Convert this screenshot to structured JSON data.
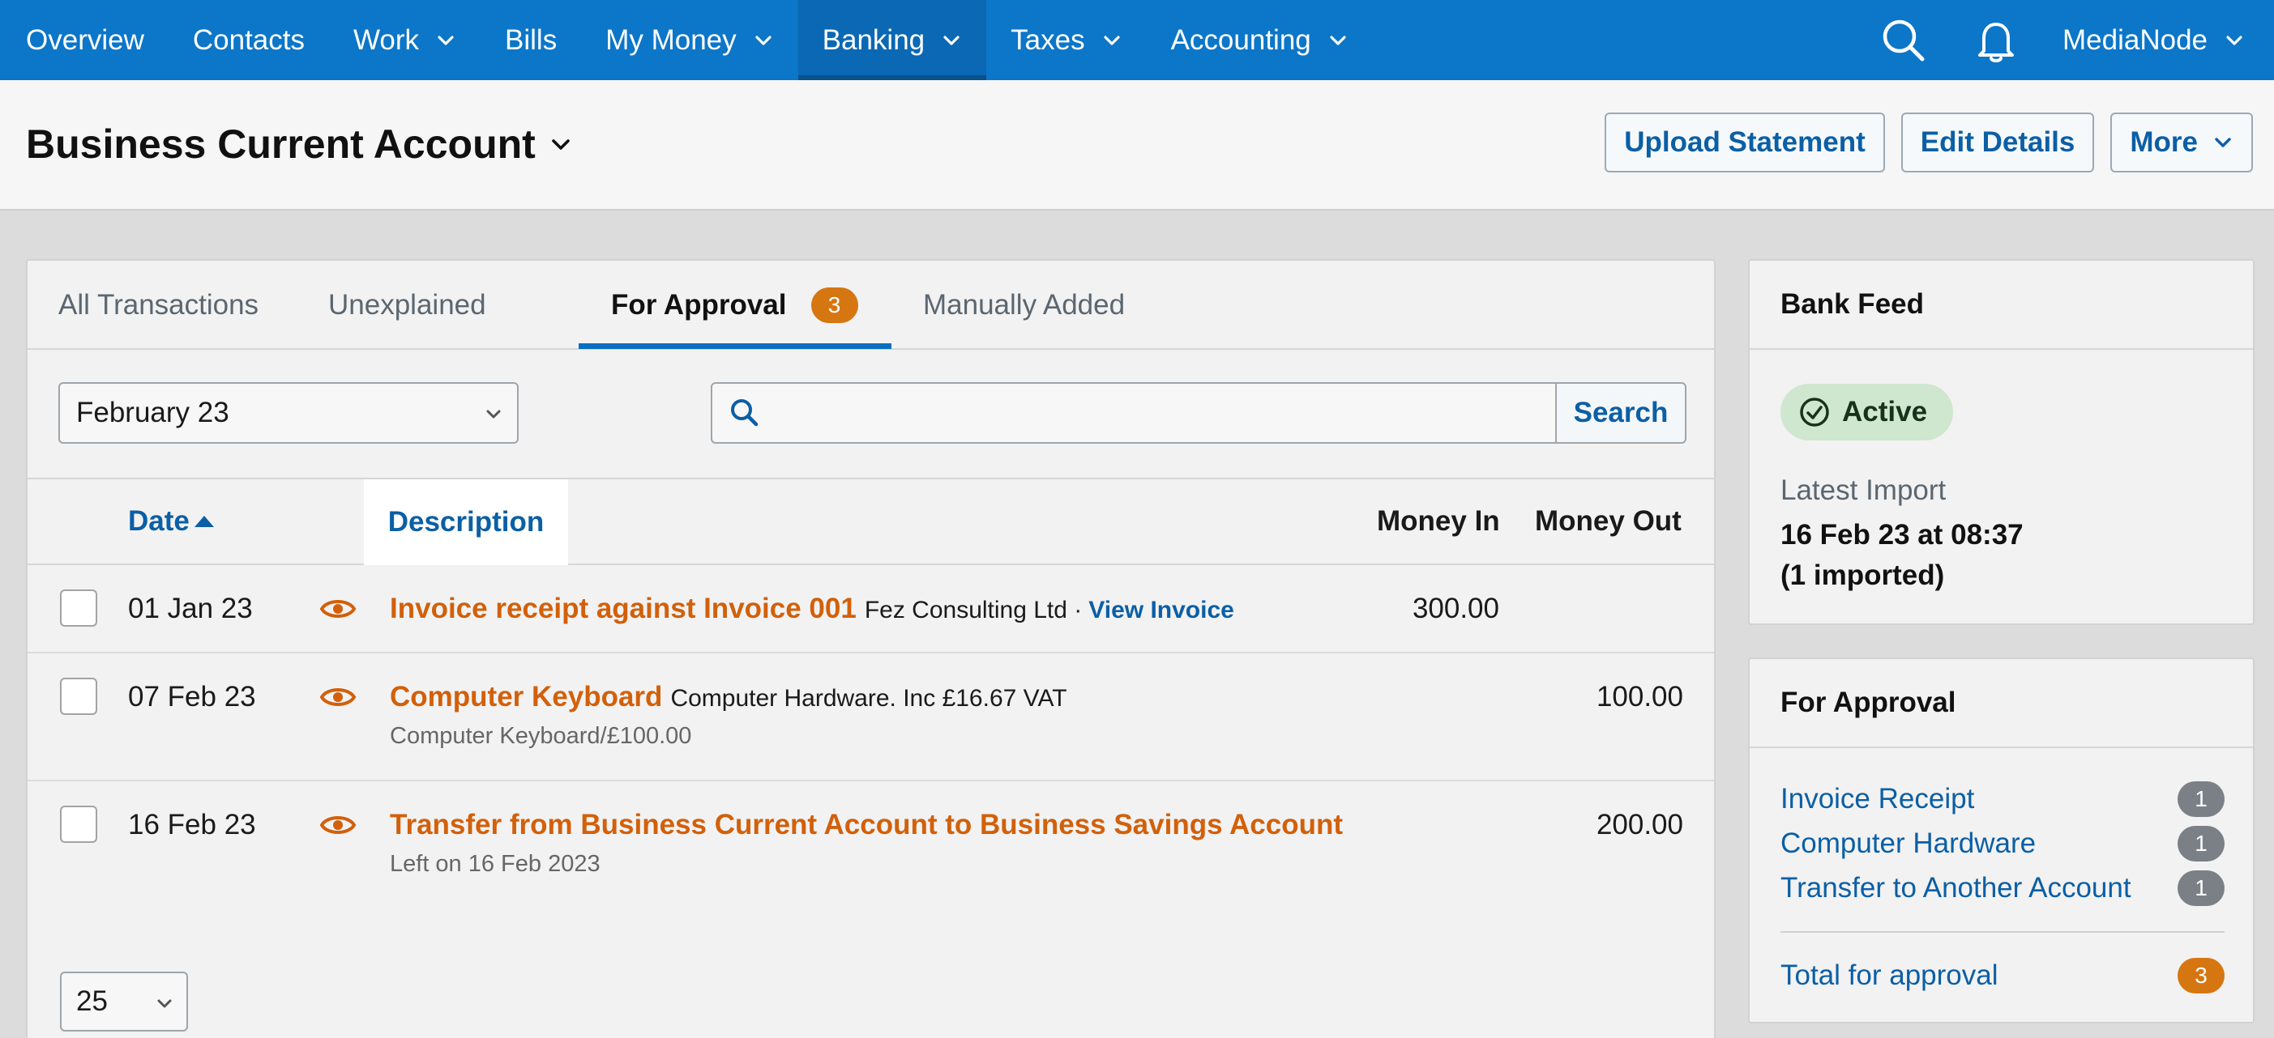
{
  "nav": {
    "items": [
      {
        "label": "Overview"
      },
      {
        "label": "Contacts"
      },
      {
        "label": "Work"
      },
      {
        "label": "Bills"
      },
      {
        "label": "My Money"
      },
      {
        "label": "Banking"
      },
      {
        "label": "Taxes"
      },
      {
        "label": "Accounting"
      }
    ],
    "user": "MediaNode",
    "icons": [
      "search-icon",
      "bell-icon"
    ],
    "colors": {
      "bar": "#0c76c8",
      "active": "#0a68b4"
    }
  },
  "header": {
    "title": "Business Current Account",
    "buttons": {
      "upload": "Upload Statement",
      "edit": "Edit Details",
      "more": "More"
    }
  },
  "tabs": {
    "all": "All Transactions",
    "unexplained": "Unexplained",
    "approval": "For Approval",
    "approval_count": "3",
    "manual": "Manually Added"
  },
  "filters": {
    "period": "February 23",
    "search_placeholder": "",
    "search_button": "Search"
  },
  "table": {
    "columns": {
      "date": "Date",
      "description": "Description",
      "money_in": "Money In",
      "money_out": "Money Out"
    },
    "rows": [
      {
        "date": "01 Jan 23",
        "title": "Invoice receipt against Invoice 001",
        "detail": "Fez Consulting Ltd ·",
        "link": "View Invoice",
        "sub": "",
        "money_in": "300.00",
        "money_out": ""
      },
      {
        "date": "07 Feb 23",
        "title": "Computer Keyboard",
        "detail": "Computer Hardware. Inc £16.67 VAT",
        "link": "",
        "sub": "Computer Keyboard/£100.00",
        "money_in": "",
        "money_out": "100.00"
      },
      {
        "date": "16 Feb 23",
        "title": "Transfer from Business Current Account to Business Savings Account",
        "detail": "",
        "link": "",
        "sub": "Left on 16 Feb 2023",
        "money_in": "",
        "money_out": "200.00"
      }
    ],
    "per_page": "25"
  },
  "bank_feed": {
    "title": "Bank Feed",
    "status": "Active",
    "latest_label": "Latest Import",
    "latest_value": "16 Feb 23 at 08:37",
    "latest_count": "(1 imported)"
  },
  "for_approval": {
    "title": "For Approval",
    "items": [
      {
        "label": "Invoice Receipt",
        "count": "1"
      },
      {
        "label": "Computer Hardware",
        "count": "1"
      },
      {
        "label": "Transfer to Another Account",
        "count": "1"
      }
    ],
    "total_label": "Total for approval",
    "total_count": "3"
  },
  "colors": {
    "link": "#0b5fa5",
    "transaction_title": "#d2600a",
    "badge_orange": "#d67611",
    "badge_gray": "#7a8086",
    "active_pill": "#cfe6cf"
  }
}
